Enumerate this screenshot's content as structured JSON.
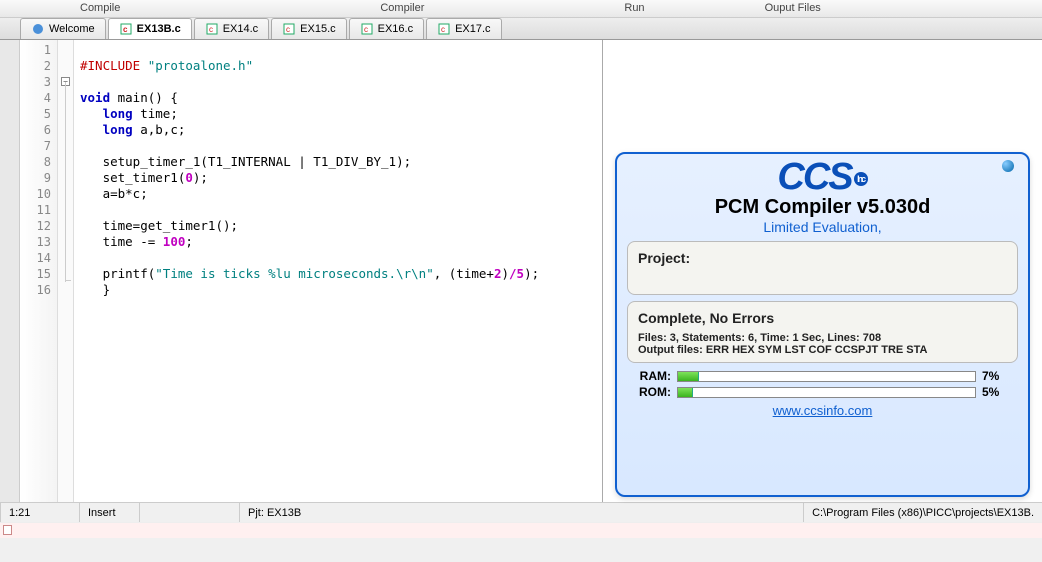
{
  "top_menu": {
    "compile": "Compile",
    "compiler": "Compiler",
    "run": "Run",
    "output": "Ouput Files"
  },
  "tabs": [
    {
      "label": "Welcome"
    },
    {
      "label": "EX13B.c"
    },
    {
      "label": "EX14.c"
    },
    {
      "label": "EX15.c"
    },
    {
      "label": "EX16.c"
    },
    {
      "label": "EX17.c"
    }
  ],
  "code": {
    "l1_pre": "#INCLUDE",
    "l1_str": "\"protoalone.h\"",
    "l3_void": "void",
    "l3_rest": " main() {",
    "l4_long": "long",
    "l4_rest": " time;",
    "l5_long": "long",
    "l5_rest": " a,b,c;",
    "l7": "   setup_timer_1(T1_INTERNAL | T1_DIV_BY_1);",
    "l8a": "   set_timer1(",
    "l8n": "0",
    "l8b": ");",
    "l9": "   a=b*c;",
    "l11": "   time=get_timer1();",
    "l12a": "   time -= ",
    "l12n": "100",
    "l12b": ";",
    "l14a": "   printf(",
    "l14s": "\"Time is ticks %lu microseconds.\\r\\n\"",
    "l14b": ", (time+",
    "l14n1": "2",
    "l14c": ")",
    "l14d": "/",
    "l14n2": "5",
    "l14e": ");",
    "l15": "   }"
  },
  "line_count": 16,
  "popup": {
    "logo_text": "CCS",
    "logo_inc": "Inc",
    "title": "PCM Compiler  v5.030d",
    "subtitle": "Limited Evaluation,",
    "project_label": "Project:",
    "project_value": "",
    "status_title": "Complete, No Errors",
    "stats_line": "Files: 3,  Statements: 6,  Time: 1 Sec,  Lines: 708",
    "output_line": "Output files: ERR  HEX  SYM  LST  COF  CCSPJT  TRE  STA",
    "ram_label": "RAM:",
    "ram_percent": "7%",
    "ram_fill": 7,
    "rom_label": "ROM:",
    "rom_percent": "5%",
    "rom_fill": 5,
    "link": "www.ccsinfo.com"
  },
  "status": {
    "position": "1:21",
    "insert": "Insert",
    "project": "Pjt: EX13B",
    "path": "C:\\Program Files (x86)\\PICC\\projects\\EX13B."
  }
}
